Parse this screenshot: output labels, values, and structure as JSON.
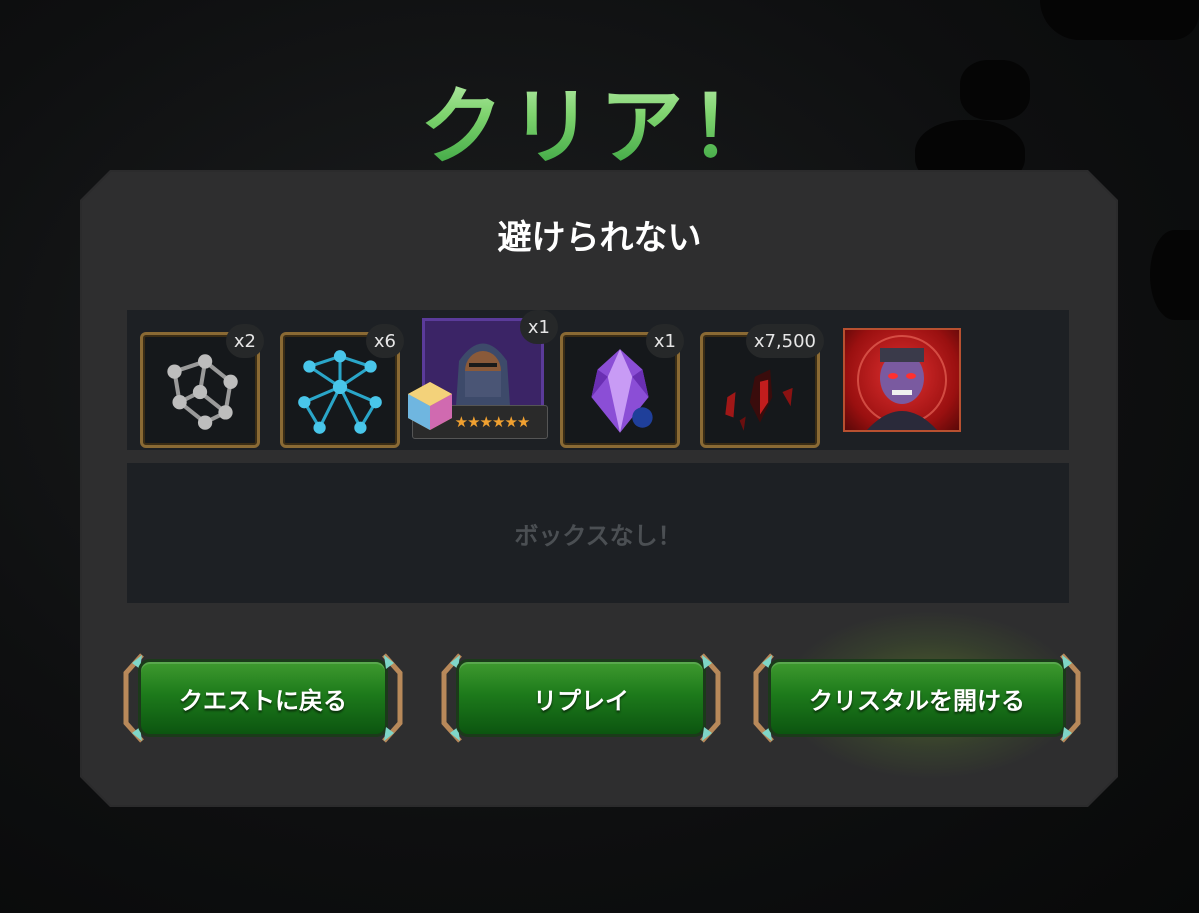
{
  "header": {
    "title": "クリア！"
  },
  "quest": {
    "name": "避けられない"
  },
  "rewards": [
    {
      "name": "gray-catalyst",
      "count": "x2"
    },
    {
      "name": "blue-catalyst",
      "count": "x6"
    },
    {
      "name": "champion",
      "count": "x1",
      "stars": "★★★★★★"
    },
    {
      "name": "purple-crystal",
      "count": "x1"
    },
    {
      "name": "red-shards",
      "count": "x7,500"
    },
    {
      "name": "boss-portrait",
      "count": ""
    }
  ],
  "boxes": {
    "empty_label": "ボックスなし！"
  },
  "buttons": {
    "back_to_quest": "クエストに戻る",
    "replay": "リプレイ",
    "open_crystal": "クリスタルを開ける"
  },
  "colors": {
    "title_green": "#5bc35a",
    "button_green": "#1d7a1b",
    "panel": "#2b2b2c",
    "strip": "#1d2024",
    "frame_gold": "#8a6a34"
  }
}
